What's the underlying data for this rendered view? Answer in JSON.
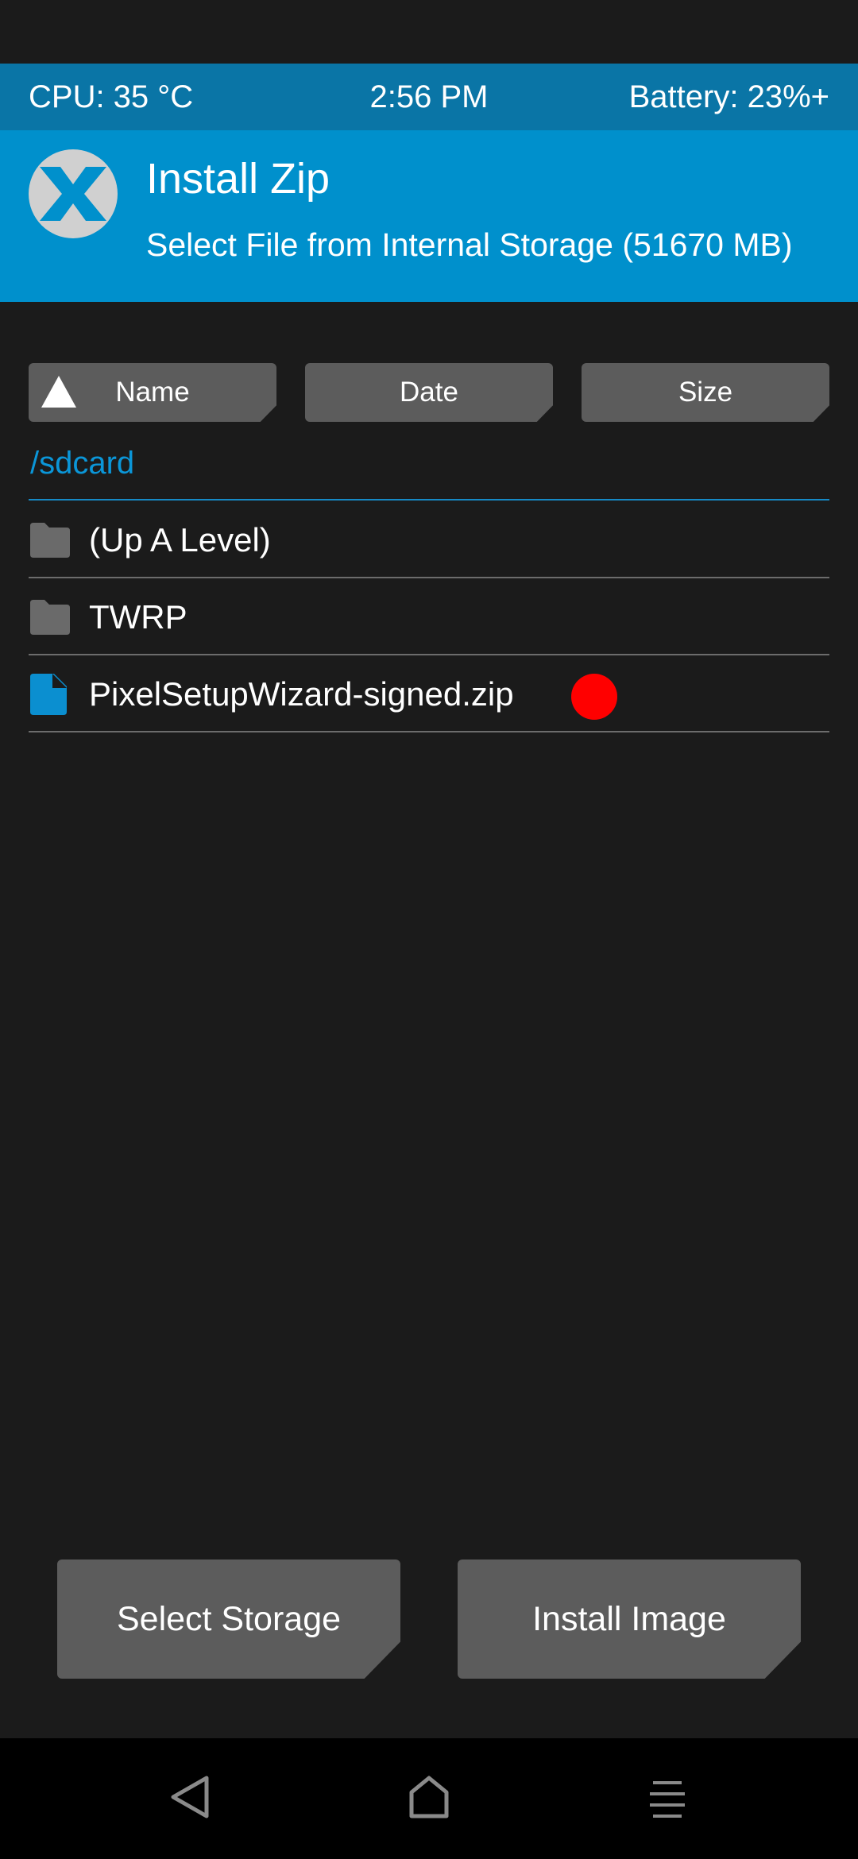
{
  "status": {
    "cpu": "CPU: 35 °C",
    "time": "2:56 PM",
    "battery": "Battery: 23%+"
  },
  "header": {
    "title": "Install Zip",
    "subtitle": "Select File from Internal Storage (51670 MB)",
    "logo_icon": "twrp-logo-icon"
  },
  "sort": {
    "name_label": "Name",
    "date_label": "Date",
    "size_label": "Size",
    "active": "name",
    "direction_icon": "sort-ascending-triangle-icon"
  },
  "path": "/sdcard",
  "files": [
    {
      "label": "(Up A Level)",
      "icon": "folder-icon"
    },
    {
      "label": "TWRP",
      "icon": "folder-icon"
    },
    {
      "label": "PixelSetupWizard-signed.zip",
      "icon": "file-icon"
    }
  ],
  "actions": {
    "select_storage": "Select Storage",
    "install_image": "Install Image"
  },
  "nav": {
    "back": "back-icon",
    "home": "home-icon",
    "menu": "menu-icon"
  },
  "colors": {
    "background": "#1b1b1b",
    "status_bar": "#0a75a6",
    "header": "#0090cc",
    "button": "#5c5c5c",
    "accent": "#0b96d8",
    "marker": "#ff0000"
  }
}
